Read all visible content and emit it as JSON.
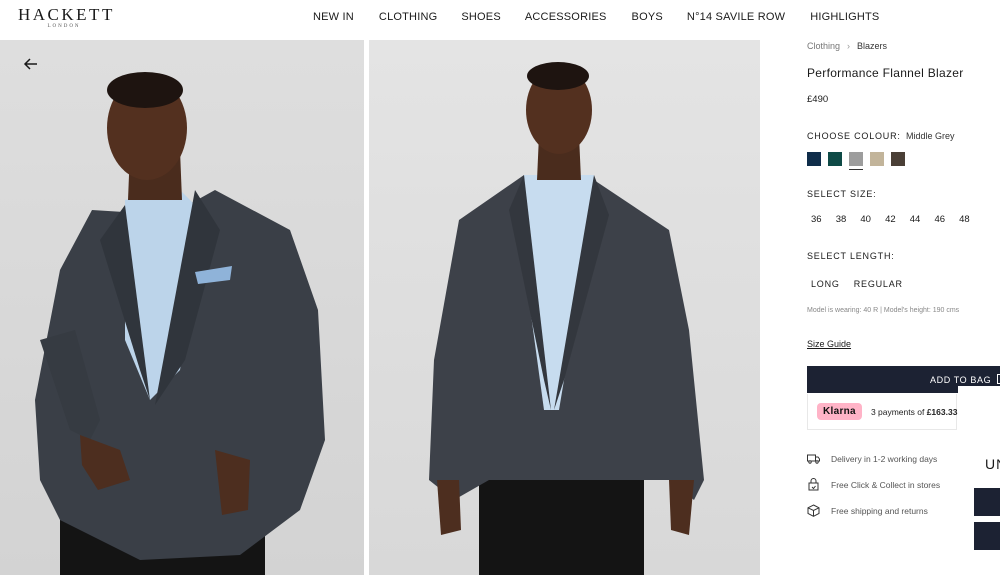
{
  "brand": {
    "name": "HACKETT",
    "sub": "LONDON"
  },
  "nav": [
    "NEW IN",
    "CLOTHING",
    "SHOES",
    "ACCESSORIES",
    "BOYS",
    "N°14 SAVILE ROW",
    "HIGHLIGHTS"
  ],
  "breadcrumb": {
    "parent": "Clothing",
    "current": "Blazers"
  },
  "product": {
    "title": "Performance Flannel Blazer",
    "price": "£490"
  },
  "colour": {
    "label": "CHOOSE COLOUR:",
    "selected": "Middle Grey",
    "swatches": [
      "#0f2d4a",
      "#0e4a46",
      "#9d9d9d",
      "#c2b49a",
      "#4a3f36"
    ]
  },
  "size": {
    "label": "SELECT SIZE:",
    "options": [
      "36",
      "38",
      "40",
      "42",
      "44",
      "46",
      "48"
    ]
  },
  "length": {
    "label": "SELECT LENGTH:",
    "options": [
      "LONG",
      "REGULAR"
    ]
  },
  "model_info": "Model is wearing: 40 R  |  Model's height: 190 cms",
  "size_guide": "Size Guide",
  "add_to_bag": "ADD TO BAG",
  "klarna": {
    "logo": "Klarna",
    "text": "3 payments of ",
    "amount": "£163.33"
  },
  "benefits": [
    {
      "icon": "truck-icon",
      "text": "Delivery in 1-2 working days"
    },
    {
      "icon": "store-icon",
      "text": "Free Click & Collect in stores"
    },
    {
      "icon": "box-icon",
      "text": "Free shipping and returns"
    }
  ],
  "popup": {
    "title_fragment": "UN"
  }
}
